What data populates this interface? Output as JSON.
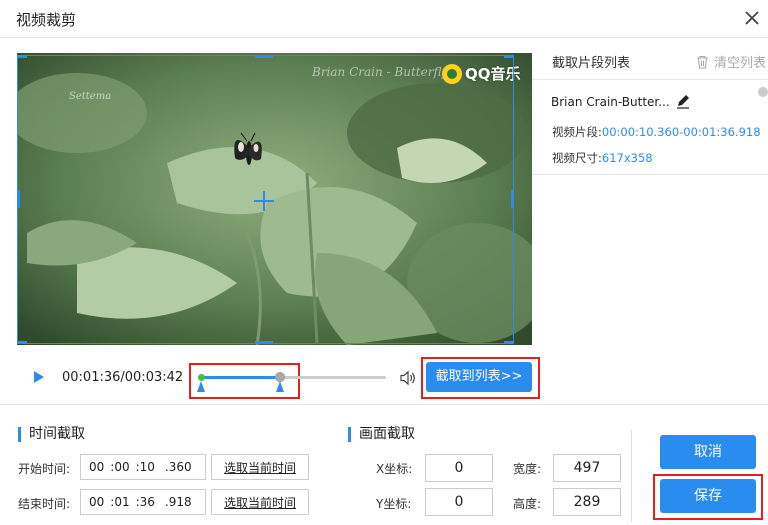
{
  "window": {
    "title": "视频裁剪",
    "close_icon": "close-icon"
  },
  "video": {
    "watermark_text": "Brian Crain - Butterfly",
    "watermark_small": "Settema",
    "qq_label": "QQ音乐"
  },
  "clip_panel": {
    "title": "截取片段列表",
    "clear_label": "清空列表",
    "items": [
      {
        "name": "Brian Crain-Butter...",
        "segment_label": "视频片段:",
        "segment_value": "00:00:10.360-00:01:36.918",
        "size_label": "视频尺寸:",
        "size_value": "617x358"
      }
    ]
  },
  "player": {
    "time": "00:01:36/00:03:42",
    "progress_fraction": 0.41,
    "add_button": "截取到列表>>"
  },
  "time_crop": {
    "title": "时间截取",
    "start_label": "开始时间:",
    "start": {
      "h": "00",
      "m": ":00",
      "s": ":10",
      "ms": ".360"
    },
    "end_label": "结束时间:",
    "end": {
      "h": "00",
      "m": ":01",
      "s": ":36",
      "ms": ".918"
    },
    "pick_label": "选取当前时间"
  },
  "frame_crop": {
    "title": "画面截取",
    "x_label": "X坐标:",
    "x_value": "0",
    "y_label": "Y坐标:",
    "y_value": "0",
    "w_label": "宽度:",
    "w_value": "497",
    "h_label": "高度:",
    "h_value": "289"
  },
  "actions": {
    "cancel": "取消",
    "save": "保存"
  },
  "colors": {
    "accent": "#2b8cf0",
    "highlight": "#e02020"
  }
}
